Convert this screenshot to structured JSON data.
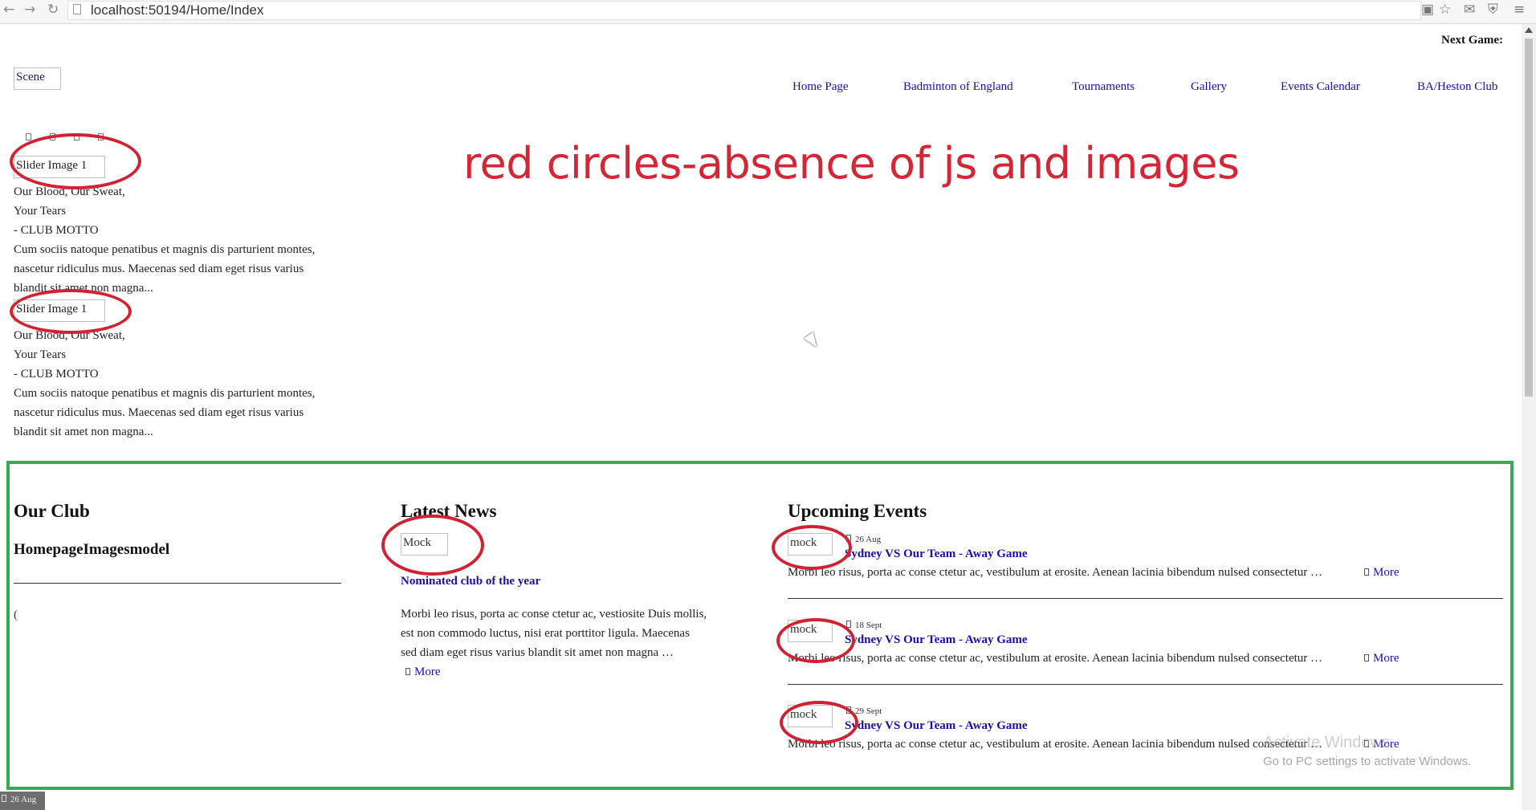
{
  "browser": {
    "url": "localhost:50194/Home/Index"
  },
  "header": {
    "next_game": "Next Game:",
    "logo_alt": "Scene",
    "nav": [
      "Home Page",
      "Badminton of England",
      "Tournaments",
      "Gallery",
      "Events Calendar",
      "BA/Heston Club"
    ]
  },
  "annotation": "red circles-absence of js and images",
  "slides": [
    {
      "img_alt": "Slider Image 1",
      "line1": "Our Blood, Our Sweat,",
      "line2": "Your Tears",
      "line3": "- CLUB MOTTO",
      "body1": "Cum sociis natoque penatibus et magnis dis parturient montes,",
      "body2": "nascetur ridiculus mus. Maecenas sed diam eget risus varius",
      "body3": "blandit sit amet non magna..."
    },
    {
      "img_alt": "Slider Image 1",
      "line1": "Our Blood, Our Sweat,",
      "line2": "Your Tears",
      "line3": "- CLUB MOTTO",
      "body1": "Cum sociis natoque penatibus et magnis dis parturient montes,",
      "body2": "nascetur ridiculus mus. Maecenas sed diam eget risus varius",
      "body3": "blandit sit amet non magna..."
    }
  ],
  "our_club": {
    "title": "Our Club",
    "subtitle": "HomepageImagesmodel",
    "paren": "("
  },
  "latest_news": {
    "title": "Latest News",
    "img_alt": "Mock",
    "link": "Nominated club of the year",
    "body1": "Morbi leo risus, porta ac conse ctetur ac, vestiosite Duis mollis,",
    "body2": "est non commodo luctus, nisi erat porttitor ligula. Maecenas",
    "body3": "sed diam eget risus varius blandit sit amet non magna …",
    "more": "More"
  },
  "upcoming_events": {
    "title": "Upcoming Events",
    "events": [
      {
        "img_alt": "mock",
        "date": "26 Aug",
        "title": "Sydney VS Our Team - Away Game",
        "text": "Morbi leo risus, porta ac conse ctetur ac, vestibulum at erosite. Aenean lacinia bibendum nulsed consectetur …",
        "more": "More"
      },
      {
        "img_alt": "mock",
        "date": "18 Sept",
        "title": "Sydney VS Our Team - Away Game",
        "text": "Morbi leo risus, porta ac conse ctetur ac, vestibulum at erosite. Aenean lacinia bibendum nulsed consectetur …",
        "more": "More"
      },
      {
        "img_alt": "mock",
        "date": "29 Sept",
        "title": "Sydney VS Our Team - Away Game",
        "text": "Morbi leo risus, porta ac conse ctetur ac, vestibulum at erosite. Aenean lacinia bibendum nulsed consectetur …",
        "more": "More"
      }
    ]
  },
  "windows_activation": {
    "line1": "Activate Windows",
    "line2": "Go to PC settings to activate Windows."
  },
  "footer_strip": "26 Aug",
  "colors": {
    "annotation_red": "#d32636",
    "frame_green": "#33aa55",
    "link_blue": "#1a0dab"
  }
}
